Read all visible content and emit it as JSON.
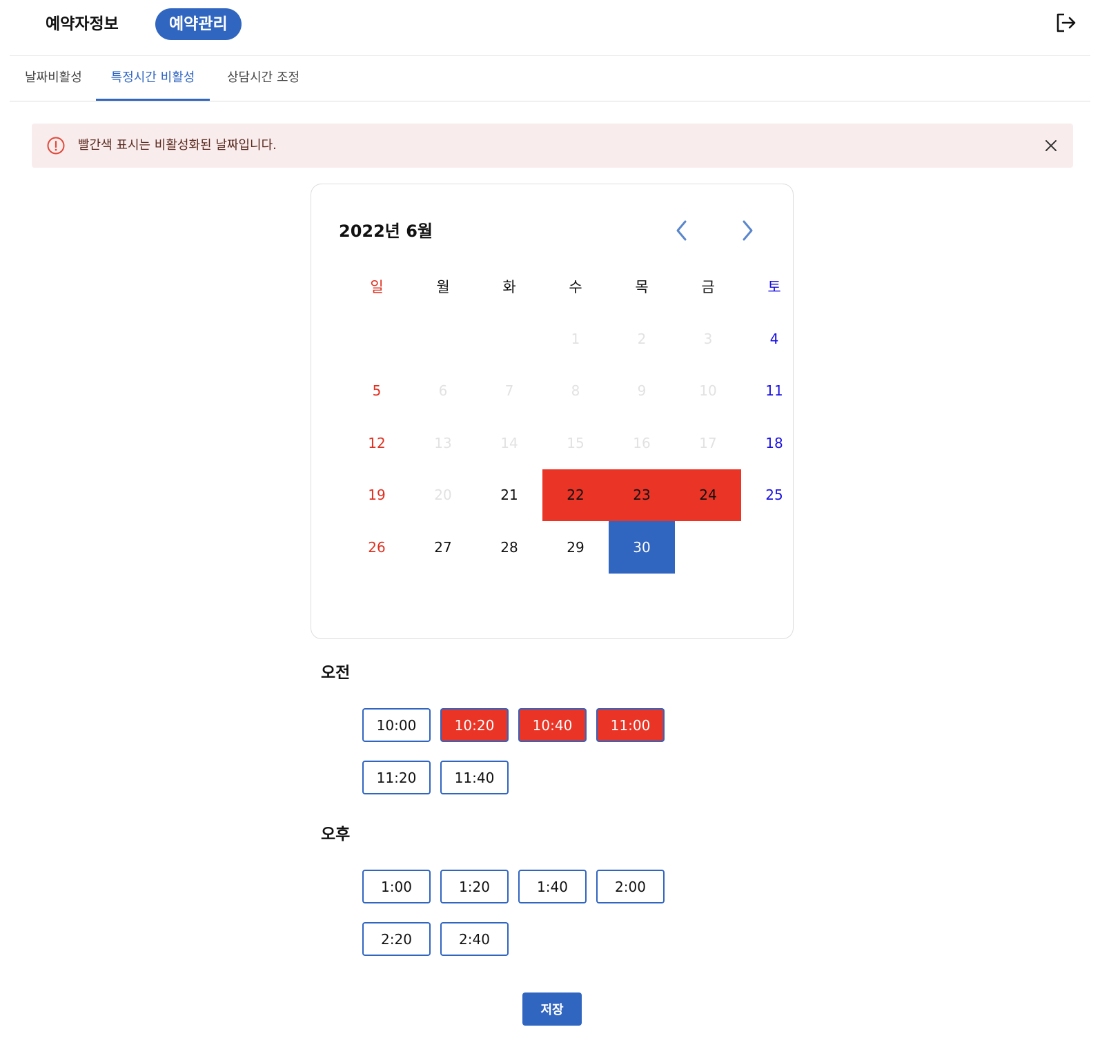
{
  "header": {
    "nav_info": "예약자정보",
    "nav_manage": "예약관리",
    "logout_icon": "logout-icon"
  },
  "subtabs": {
    "tab1": "날짜비활성",
    "tab2": "특정시간 비활성",
    "tab3": "상담시간 조정",
    "active": "특정시간 비활성"
  },
  "alert": {
    "text": "빨간색 표시는 비활성화된 날짜입니다.",
    "icon": "alert-circle-icon",
    "close_icon": "close-icon"
  },
  "calendar": {
    "title": "2022년 6월",
    "weekdays": [
      "일",
      "월",
      "화",
      "수",
      "목",
      "금",
      "토"
    ],
    "weeks": [
      [
        "",
        "",
        "",
        "1",
        "2",
        "3",
        "4"
      ],
      [
        "5",
        "6",
        "7",
        "8",
        "9",
        "10",
        "11"
      ],
      [
        "12",
        "13",
        "14",
        "15",
        "16",
        "17",
        "18"
      ],
      [
        "19",
        "20",
        "21",
        "22",
        "23",
        "24",
        "25"
      ],
      [
        "26",
        "27",
        "28",
        "29",
        "30",
        "",
        ""
      ]
    ],
    "past_days": [
      "1",
      "2",
      "3",
      "6",
      "7",
      "8",
      "9",
      "10",
      "13",
      "14",
      "15",
      "16",
      "17",
      "20"
    ],
    "disabled_days": [
      "22",
      "23",
      "24"
    ],
    "selected_day": "30"
  },
  "morning": {
    "title": "오전",
    "slots": [
      {
        "time": "10:00",
        "blocked": false
      },
      {
        "time": "10:20",
        "blocked": true
      },
      {
        "time": "10:40",
        "blocked": true
      },
      {
        "time": "11:00",
        "blocked": true
      },
      {
        "time": "11:20",
        "blocked": false
      },
      {
        "time": "11:40",
        "blocked": false
      }
    ]
  },
  "afternoon": {
    "title": "오후",
    "slots": [
      {
        "time": "1:00",
        "blocked": false
      },
      {
        "time": "1:20",
        "blocked": false
      },
      {
        "time": "1:40",
        "blocked": false
      },
      {
        "time": "2:00",
        "blocked": false
      },
      {
        "time": "2:20",
        "blocked": false
      },
      {
        "time": "2:40",
        "blocked": false
      }
    ]
  },
  "save_label": "저장",
  "colors": {
    "primary": "#3065c0",
    "disabled_red": "#e93426",
    "alert_bg": "#f9ecec",
    "sunday": "#e03020",
    "saturday": "#1a10e0"
  }
}
